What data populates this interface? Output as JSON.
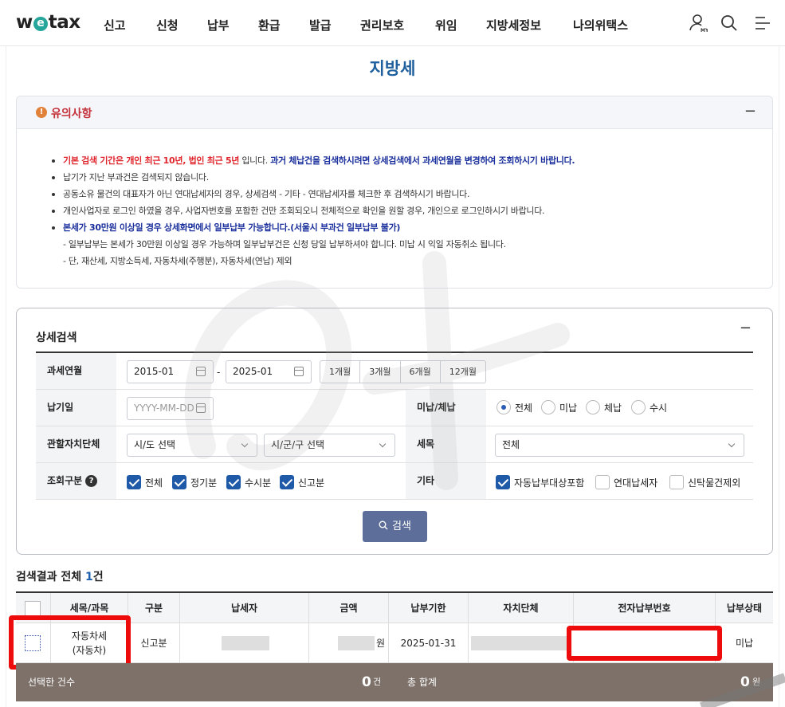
{
  "header": {
    "logo_pre": "w",
    "logo_mid": "e",
    "logo_post": "tax",
    "nav": [
      "신고",
      "신청",
      "납부",
      "환급",
      "발급",
      "권리보호",
      "위임",
      "지방세정보",
      "나의위택스"
    ],
    "icons": [
      "user-my-icon",
      "search-icon",
      "menu-icon"
    ]
  },
  "page": {
    "title": "지방세"
  },
  "notice": {
    "title": "유의사항",
    "warn_glyph": "!",
    "collapse_glyph": "−",
    "line1_red": "기본 검색 기간은 개인 최근 10년, 법인 최근 5년",
    "line1_mid": " 입니다. ",
    "line1_navy": "과거 체납건을 검색하시려면 상세검색에서 과세연월을 변경하여 조회하시기 바랍니다.",
    "line2": "납기가 지난 부과건은 검색되지 않습니다.",
    "line3": "공동소유 물건의 대표자가 아닌 연대납세자의 경우, 상세검색 - 기타 - 연대납세자를 체크한 후 검색하시기 바랍니다.",
    "line4": "개인사업자로 로그인 하였을 경우, 사업자번호를 포함한 건만 조회되오니 전체적으로 확인을 원할 경우, 개인으로 로그인하시기 바랍니다.",
    "line5": "본세가 30만원 이상일 경우 상세화면에서 일부납부 가능합니다.(서울시 부과건 일부납부 불가)",
    "line6": "- 일부납부는 본세가 30만원 이상일 경우 가능하며 일부납부건은 신청 당일 납부하셔야 합니다. 미납 시 익일 자동취소 됩니다.",
    "line7": "- 단, 재산세, 지방소득세, 자동차세(주행분), 자동차세(연납) 제외"
  },
  "search": {
    "title": "상세검색",
    "collapse_glyph": "−",
    "tax_period_label": "과세연월",
    "tax_period_from": "2015-01",
    "tax_period_to": "2025-01",
    "range_sep": "-",
    "period_buttons": [
      "1개월",
      "3개월",
      "6개월",
      "12개월"
    ],
    "due_date_label": "납기일",
    "due_date_placeholder": "YYYY-MM-DD",
    "unpaid_label": "미납/체납",
    "unpaid_options": [
      "전체",
      "미납",
      "체납",
      "수시"
    ],
    "unpaid_selected": "전체",
    "jurisdiction_label": "관할자치단체",
    "sido_value": "시/도 선택",
    "sigungu_value": "시/군/구 선택",
    "tax_item_label": "세목",
    "tax_item_value": "전체",
    "inquiry_type_label": "조회구분",
    "inquiry_help_glyph": "?",
    "inquiry_types": [
      {
        "label": "전체",
        "checked": true
      },
      {
        "label": "정기분",
        "checked": true
      },
      {
        "label": "수시분",
        "checked": true
      },
      {
        "label": "신고분",
        "checked": true
      }
    ],
    "etc_label": "기타",
    "etc_options": [
      {
        "label": "자동납부대상포함",
        "checked": true
      },
      {
        "label": "연대납세자",
        "checked": false
      },
      {
        "label": "신탁물건제외",
        "checked": false
      }
    ],
    "search_button": "검색"
  },
  "results": {
    "title_prefix": "검색결과 전체 ",
    "count": "1",
    "count_unit": "건",
    "columns": [
      "세목/과목",
      "구분",
      "납세자",
      "금액",
      "납부기한",
      "자치단체",
      "전자납부번호",
      "납부상태"
    ],
    "row": {
      "tax_item_line1": "자동차세",
      "tax_item_line2": "(자동차)",
      "type": "신고분",
      "amount_unit": "원",
      "due_date": "2025-01-31",
      "status": "미납"
    },
    "summary": {
      "selected_label": "선택한 건수",
      "selected_count": "0",
      "selected_unit": "건",
      "total_label": "총 합계",
      "total_amount": "0",
      "total_unit": "원"
    }
  },
  "colors": {
    "accent_blue": "#1f5f9e",
    "notice_red": "#e0252c",
    "notice_navy": "#1a2f9c",
    "checkbox_blue": "#1e5aa8",
    "search_button": "#5d6e9b",
    "summary_bar": "#7d716a",
    "highlight_red": "#ee0b0b"
  }
}
